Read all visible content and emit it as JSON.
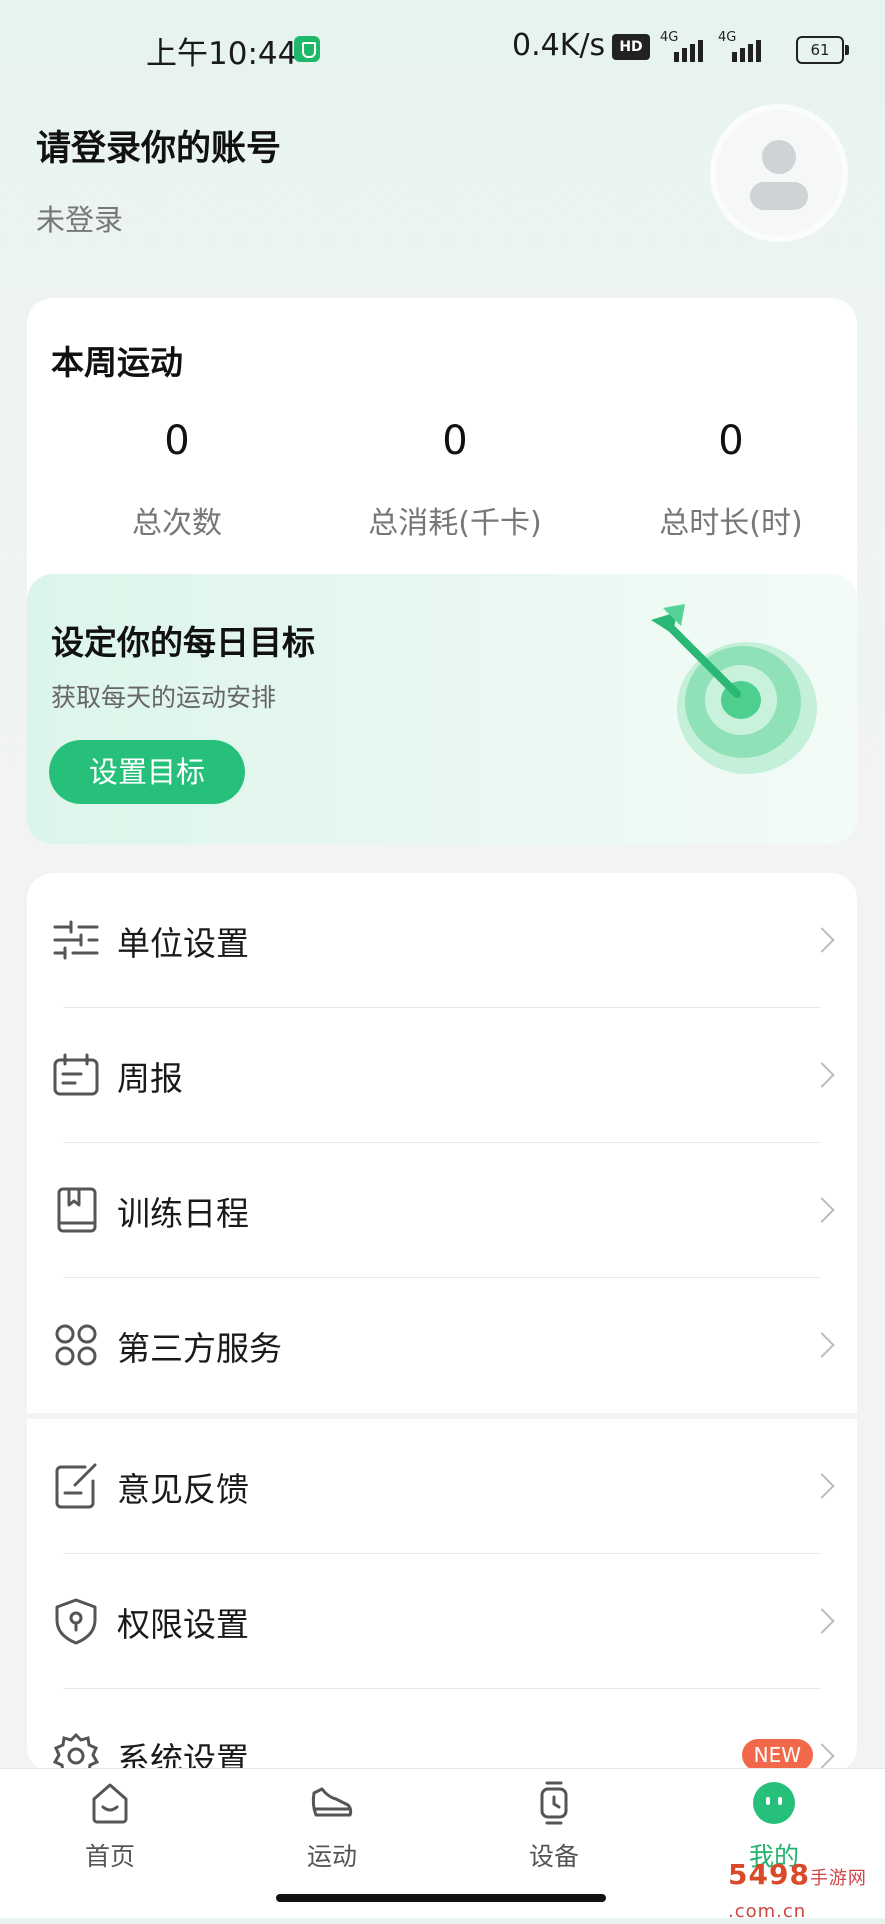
{
  "status_bar": {
    "time": "上午10:44",
    "speed": "0.4K/s",
    "hd": "HD",
    "network1": "4G",
    "network2": "4G",
    "battery": "61"
  },
  "profile": {
    "title": "请登录你的账号",
    "subtitle": "未登录"
  },
  "week_stats": {
    "title": "本周运动",
    "items": [
      {
        "value": "0",
        "label": "总次数"
      },
      {
        "value": "0",
        "label": "总消耗(千卡)"
      },
      {
        "value": "0",
        "label": "总时长(时)"
      }
    ]
  },
  "goal": {
    "title": "设定你的每日目标",
    "subtitle": "获取每天的运动安排",
    "button": "设置目标"
  },
  "menu": {
    "items": [
      {
        "label": "单位设置",
        "icon": "sliders-icon"
      },
      {
        "label": "周报",
        "icon": "calendar-icon"
      },
      {
        "label": "训练日程",
        "icon": "book-icon"
      },
      {
        "label": "第三方服务",
        "icon": "grid-icon"
      },
      {
        "label": "意见反馈",
        "icon": "feedback-icon"
      },
      {
        "label": "权限设置",
        "icon": "shield-lock-icon"
      },
      {
        "label": "系统设置",
        "icon": "gear-icon",
        "badge": "NEW"
      }
    ]
  },
  "tabs": [
    {
      "label": "首页",
      "icon": "home-icon"
    },
    {
      "label": "运动",
      "icon": "shoe-icon"
    },
    {
      "label": "设备",
      "icon": "watch-icon"
    },
    {
      "label": "我的",
      "icon": "smile-icon",
      "active": true
    }
  ],
  "watermark": {
    "brand": "5498",
    "site": "手游网",
    "domain": ".com.cn"
  },
  "colors": {
    "accent": "#27c07a",
    "badge": "#f2684a"
  }
}
